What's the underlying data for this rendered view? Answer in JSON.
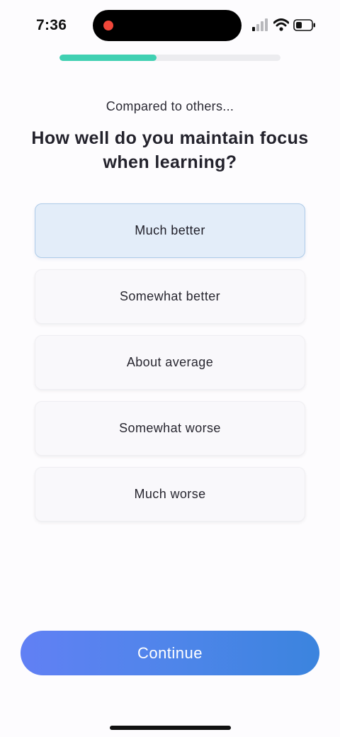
{
  "status_bar": {
    "time": "7:36",
    "icons": [
      "cellular-signal-icon",
      "wifi-icon",
      "battery-icon"
    ],
    "recording_color": "#f0473a"
  },
  "progress": {
    "value": 0.44,
    "color": "#40d0b2"
  },
  "header": {
    "subtitle": "Compared to others...",
    "question": "How well do you maintain focus when learning?"
  },
  "options": [
    {
      "label": "Much better",
      "selected": true
    },
    {
      "label": "Somewhat better",
      "selected": false
    },
    {
      "label": "About average",
      "selected": false
    },
    {
      "label": "Somewhat worse",
      "selected": false
    },
    {
      "label": "Much worse",
      "selected": false
    }
  ],
  "continue_button": {
    "label": "Continue",
    "gradient": [
      "#6180f4",
      "#3b84de"
    ]
  },
  "colors": {
    "selected_background": "#e3edf9",
    "selected_border": "#aecbe8",
    "option_background": "#f9f8fb"
  }
}
